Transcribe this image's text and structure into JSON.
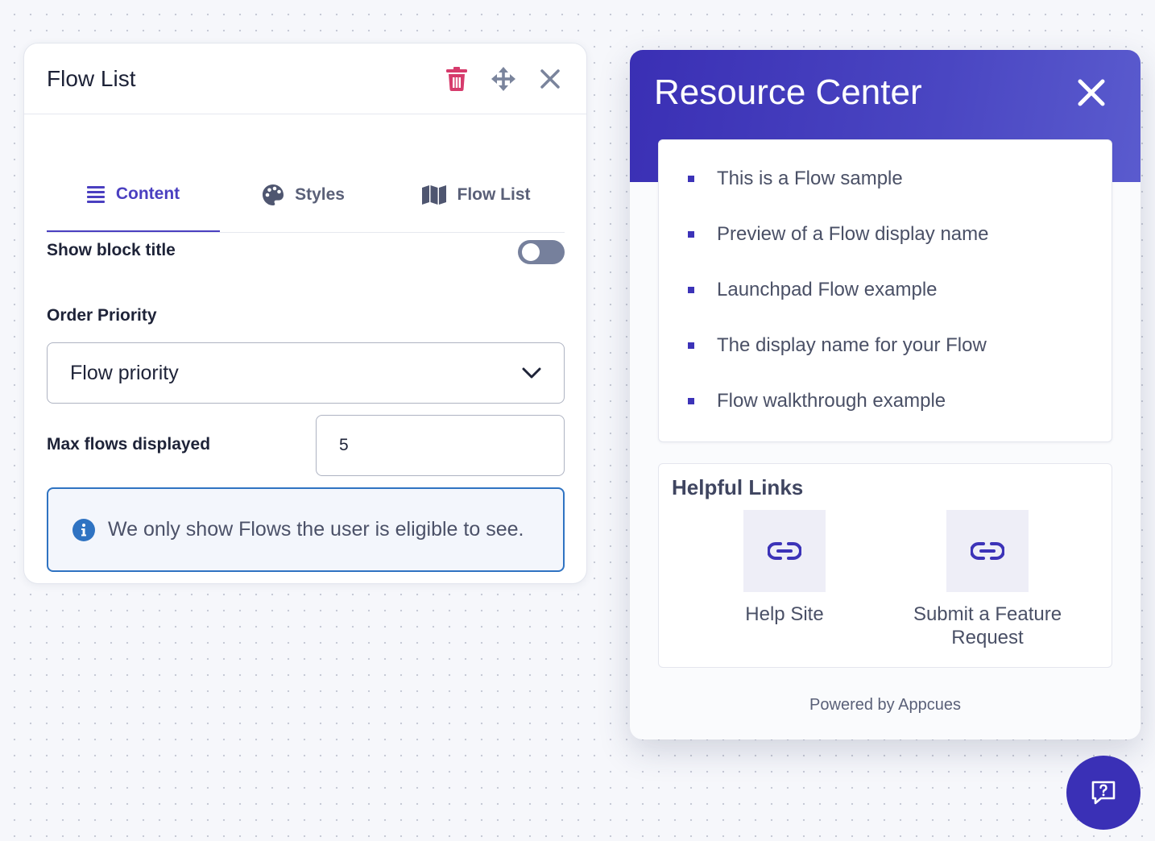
{
  "editor": {
    "title": "Flow List",
    "tabs": [
      {
        "label": "Content",
        "icon": "list-icon",
        "active": true
      },
      {
        "label": "Styles",
        "icon": "palette-icon",
        "active": false
      },
      {
        "label": "Flow List",
        "icon": "map-icon",
        "active": false
      }
    ],
    "show_block_title": {
      "label": "Show block title",
      "enabled": false
    },
    "order_priority": {
      "label": "Order Priority",
      "selected": "Flow priority"
    },
    "max_flows": {
      "label": "Max flows displayed",
      "value": "5"
    },
    "info": "We only show Flows the user is eligible to see."
  },
  "resource_center": {
    "title": "Resource Center",
    "flows": [
      "This is a Flow sample",
      "Preview of a Flow display name",
      "Launchpad Flow example",
      "The display name for your Flow",
      "Flow walkthrough example"
    ],
    "helpful_links": {
      "title": "Helpful Links",
      "links": [
        {
          "label": "Help Site"
        },
        {
          "label_line1": "Submit a Feature",
          "label_line2": "Request"
        }
      ]
    },
    "footer": "Powered by Appcues"
  },
  "colors": {
    "accent": "#4a3fc0",
    "header_gradient_start": "#3a2fb4",
    "delete": "#d63b6c",
    "info_border": "#2f73c2"
  }
}
